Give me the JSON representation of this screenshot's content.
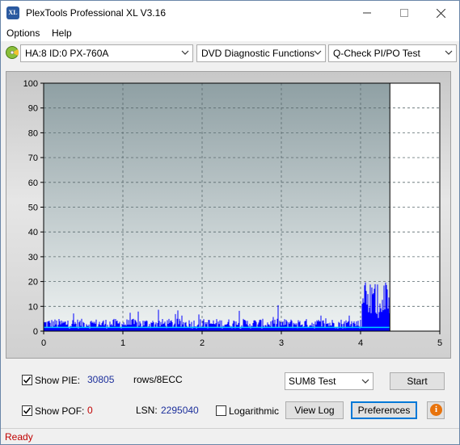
{
  "window": {
    "title": "PlexTools Professional XL V3.16",
    "app_icon_text": "XL",
    "controls": [
      "minimize",
      "maximize",
      "close"
    ]
  },
  "menu": [
    {
      "label": "Options",
      "underline": "O"
    },
    {
      "label": "Help",
      "underline": "H"
    }
  ],
  "toolbar": {
    "drive": "HA:8 ID:0  PX-760A",
    "function": "DVD Diagnostic Functions",
    "test": "Q-Check PI/PO Test"
  },
  "chart_data": {
    "type": "bar",
    "ylim": [
      0,
      100
    ],
    "xlim": [
      0,
      5
    ],
    "yticks": [
      "100",
      "90",
      "80",
      "70",
      "60",
      "50",
      "40",
      "30",
      "20",
      "10",
      "0"
    ],
    "xticks": [
      "0",
      "1",
      "2",
      "3",
      "4",
      "5"
    ],
    "data_end_x": 4.37,
    "grid": true,
    "series": [
      {
        "color": "#0000ff",
        "typical_range": [
          1,
          6
        ],
        "spikes_near_end": [
          10,
          20
        ]
      },
      {
        "color": "#00ccff",
        "typical": 1.5
      }
    ]
  },
  "bottom": {
    "show_pie_label": "Show PIE:",
    "show_pie_value": "30805",
    "rows_label": "rows/8ECC",
    "show_pof_label": "Show POF:",
    "show_pof_value": "0",
    "lsn_label": "LSN:",
    "lsn_value": "2295040",
    "log_label": "Logarithmic",
    "sum_select": "SUM8 Test",
    "start_btn": "Start",
    "viewlog_btn": "View Log",
    "prefs_btn": "Preferences",
    "info_glyph": "i"
  },
  "status": {
    "text": "Ready"
  }
}
